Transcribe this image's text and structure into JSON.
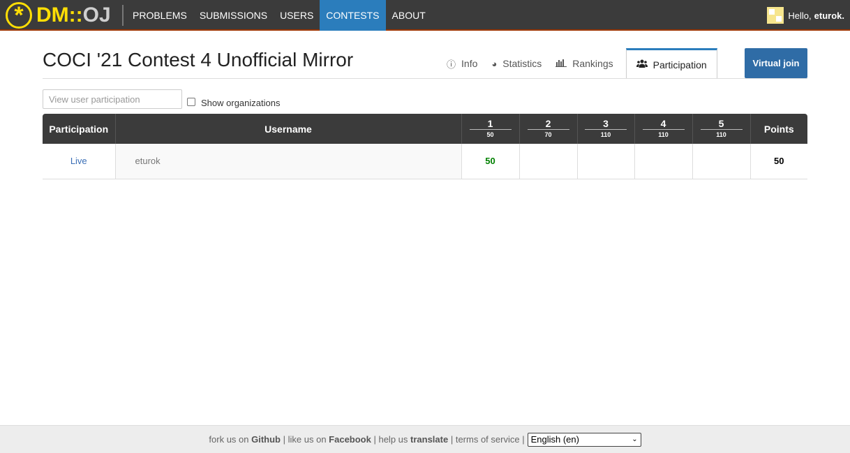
{
  "nav": {
    "logo_dm": "DM::",
    "logo_oj": "OJ",
    "items": [
      "PROBLEMS",
      "SUBMISSIONS",
      "USERS",
      "CONTESTS",
      "ABOUT"
    ],
    "active": "CONTESTS",
    "greeting": "Hello,",
    "username": "eturok."
  },
  "page": {
    "title": "COCI '21 Contest 4 Unofficial Mirror",
    "tabs": [
      {
        "label": "Info",
        "icon": "info-circle-icon"
      },
      {
        "label": "Statistics",
        "icon": "pie-chart-icon"
      },
      {
        "label": "Rankings",
        "icon": "bar-chart-icon"
      },
      {
        "label": "Participation",
        "icon": "users-icon"
      }
    ],
    "active_tab": "Participation",
    "virtual_join": "Virtual join"
  },
  "filter": {
    "search_placeholder": "View user participation",
    "show_orgs_label": "Show organizations",
    "show_orgs_checked": false
  },
  "table": {
    "headers": {
      "participation": "Participation",
      "username": "Username",
      "points": "Points"
    },
    "problems": [
      {
        "num": "1",
        "points": "50"
      },
      {
        "num": "2",
        "points": "70"
      },
      {
        "num": "3",
        "points": "110"
      },
      {
        "num": "4",
        "points": "110"
      },
      {
        "num": "5",
        "points": "110"
      }
    ],
    "rows": [
      {
        "participation": "Live",
        "username": "eturok",
        "scores": [
          "50",
          "",
          "",
          "",
          ""
        ],
        "total": "50"
      }
    ]
  },
  "footer": {
    "fork_text": "fork us on",
    "github": "Github",
    "like_text": "like us on",
    "facebook": "Facebook",
    "help_text": "help us",
    "translate": "translate",
    "tos": "terms of service",
    "language": "English (en)"
  },
  "colors": {
    "nav_bg": "#3b3b3b",
    "accent": "#2b7dbc",
    "logo": "#ffde05",
    "full_score": "#008000"
  }
}
